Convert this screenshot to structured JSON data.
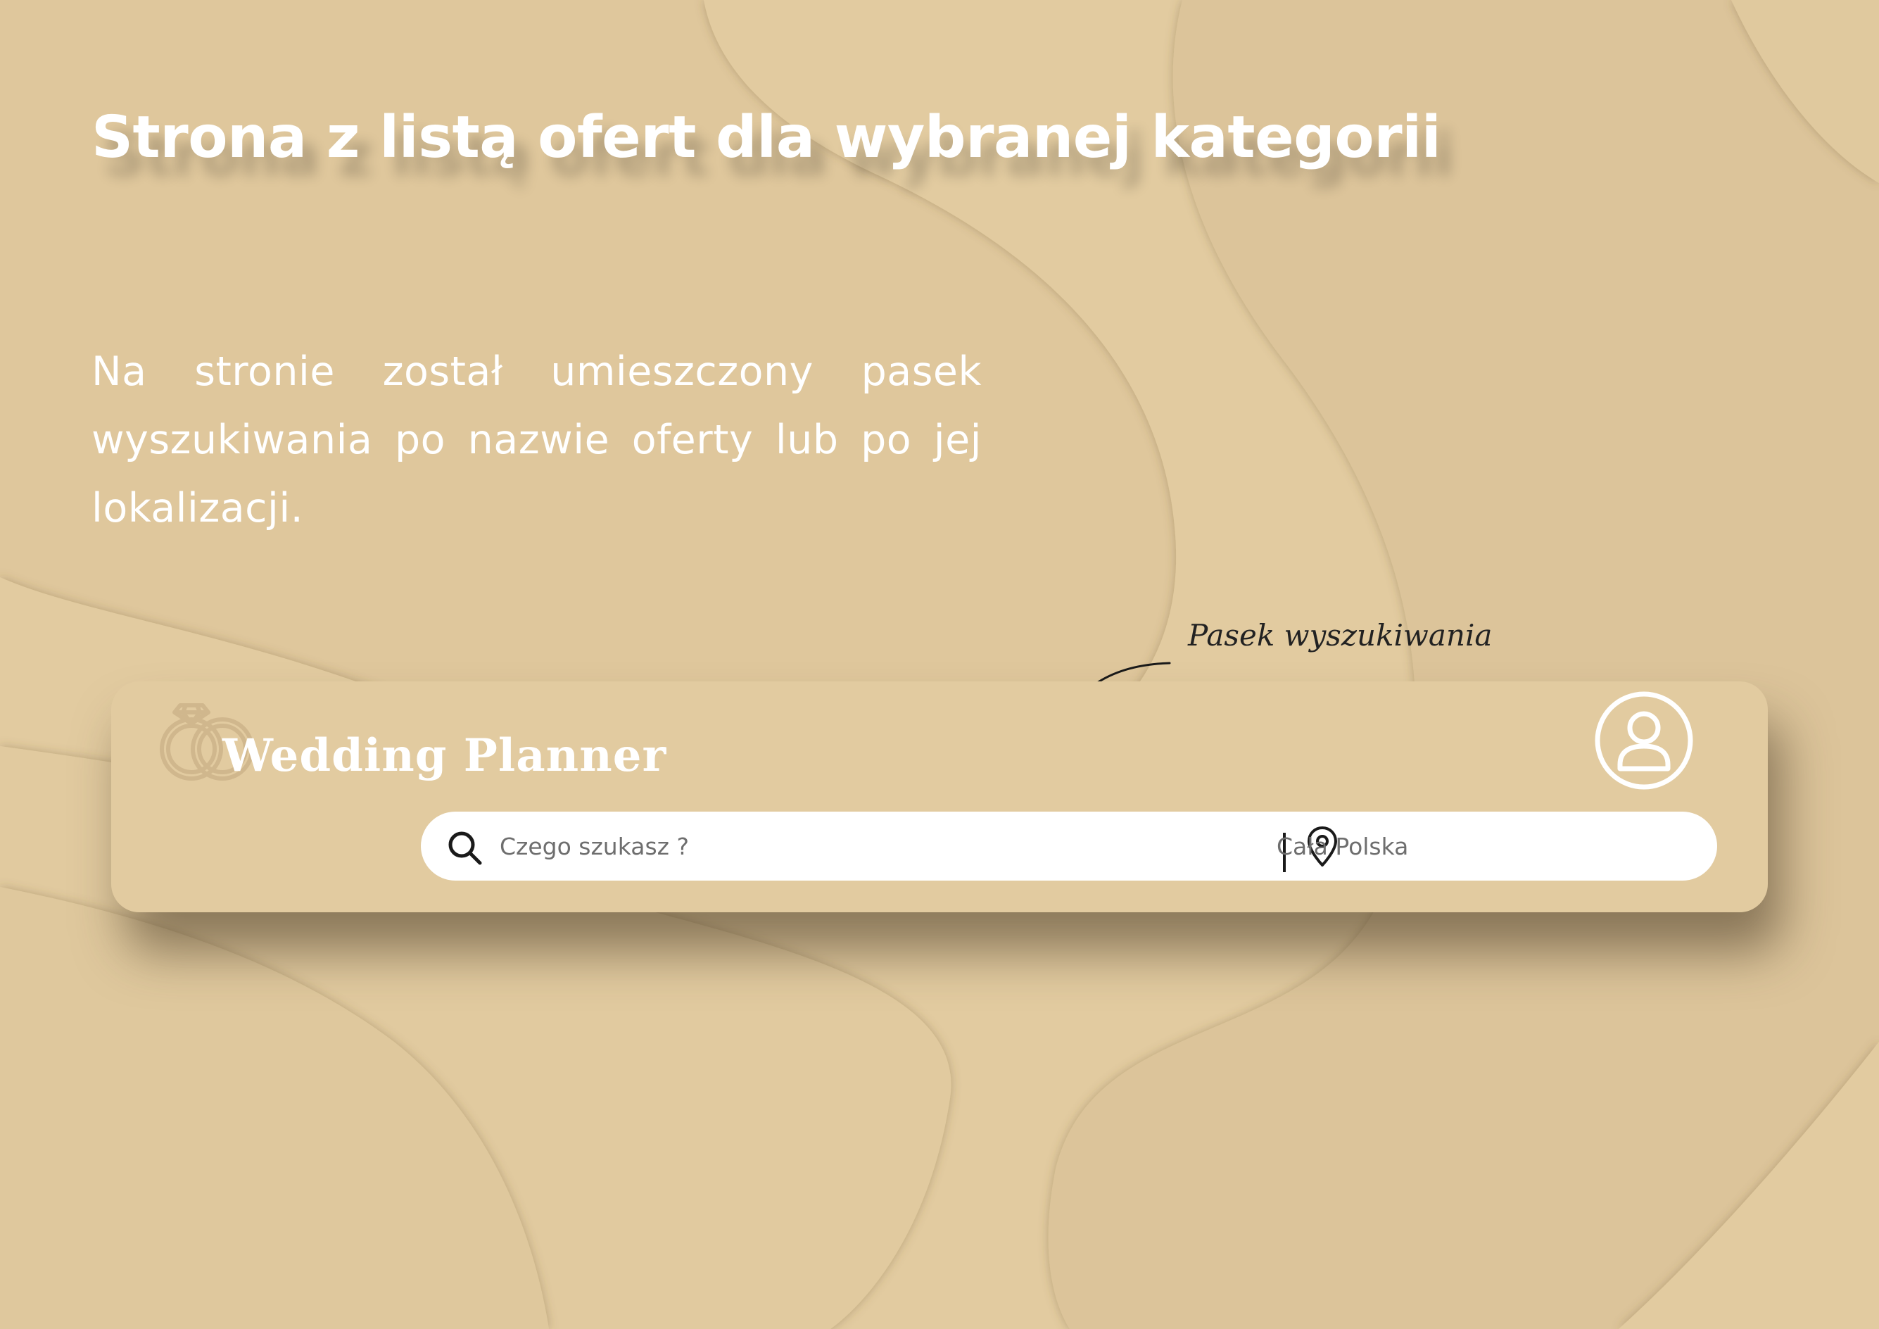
{
  "slide": {
    "title": "Strona z listą ofert dla wybranej kategorii",
    "description": "Na stronie został umieszczony pasek wyszukiwania po nazwie oferty lub po jej lokalizacji.",
    "annotation": "Pasek wyszukiwania"
  },
  "header": {
    "logo_text": "Wedding Planner",
    "logo_icon": "rings-icon",
    "avatar_icon": "user-icon"
  },
  "search": {
    "query_placeholder": "Czego szukasz ?",
    "query_value": "",
    "search_icon": "search-icon",
    "location_placeholder": "Cała Polska",
    "location_value": "",
    "location_icon": "map-pin-icon"
  },
  "colors": {
    "background": "#e2cba0",
    "text_light": "#ffffff",
    "search_bg": "#ffffff",
    "icon_dark": "#1a1a1a"
  }
}
